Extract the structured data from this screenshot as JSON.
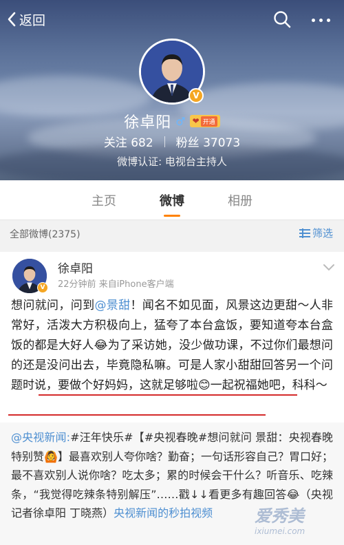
{
  "topbar": {
    "back_label": "返回"
  },
  "profile": {
    "name": "徐卓阳",
    "gender_symbol": "♂",
    "vip_label": "开通",
    "follow_label": "关注",
    "follow_count": "682",
    "fans_label": "粉丝",
    "fans_count": "37073",
    "verification": "微博认证: 电视台主持人",
    "verify_badge": "V"
  },
  "tabs": [
    {
      "label": "主页",
      "active": false
    },
    {
      "label": "微博",
      "active": true
    },
    {
      "label": "相册",
      "active": false
    }
  ],
  "filterbar": {
    "count_label": "全部微博(2375)",
    "filter_label": "筛选"
  },
  "post": {
    "author": "徐卓阳",
    "time": "22分钟前",
    "source": "来自iPhone客户端",
    "text_1": "想问就问，问到",
    "mention": "@景甜",
    "text_2": "！闻名不如见面，风景这边更甜～人非常好，活泼大方积极向上，猛夸了本台盒饭，要知道夸本台盒饭的都是大好人😂为了采访她，没少做功课，不过你们最想问的还是没问出去，毕竟隐私嘛。可是人家小甜甜回答另一个问题时说，要做个好妈妈，这就足够啦😊一起祝福她吧，科科～",
    "repost_mention": "@央视新闻:#汪年快乐#【#央视春晚#想问就问 景甜：央视春晚特别赞🙆】最喜欢别人夸你啥？勤奋；一句话形容自己？胃口好；最不喜欢别人说你啥？吃太多；累的时候会干什么？听音乐、吃辣条，“我觉得吃辣条特别解压”……戳↓↓看更多有趣回答😂（央视记者徐卓阳 丁晓燕）",
    "repost_link": "央视新闻的秒拍视频"
  },
  "watermark": {
    "text": "爱秀美",
    "sub": "ixiumei.com"
  },
  "colors": {
    "accent": "#ff8200",
    "link": "#4e8fd1",
    "underline": "#d42a2a"
  }
}
